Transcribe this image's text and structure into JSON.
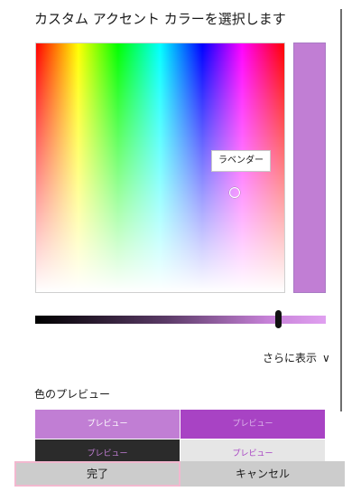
{
  "dialog": {
    "title": "カスタム アクセント カラーを選択します"
  },
  "picker": {
    "tooltip": "ラベンダー",
    "selected_color": "#c17ed4",
    "brightness_percent": 83
  },
  "more": {
    "label": "さらに表示"
  },
  "preview": {
    "label": "色のプレビュー",
    "tiles": [
      {
        "text": "プレビュー",
        "bg": "#c17ed4",
        "fg": "#ffffff"
      },
      {
        "text": "プレビュー",
        "bg": "#a843c4",
        "fg": "#dcb7ea"
      },
      {
        "text": "プレビュー",
        "bg": "#2b2b2b",
        "fg": "#c17ed4"
      },
      {
        "text": "プレビュー",
        "bg": "#e6e6e6",
        "fg": "#a843c4"
      }
    ]
  },
  "buttons": {
    "done": "完了",
    "cancel": "キャンセル"
  }
}
